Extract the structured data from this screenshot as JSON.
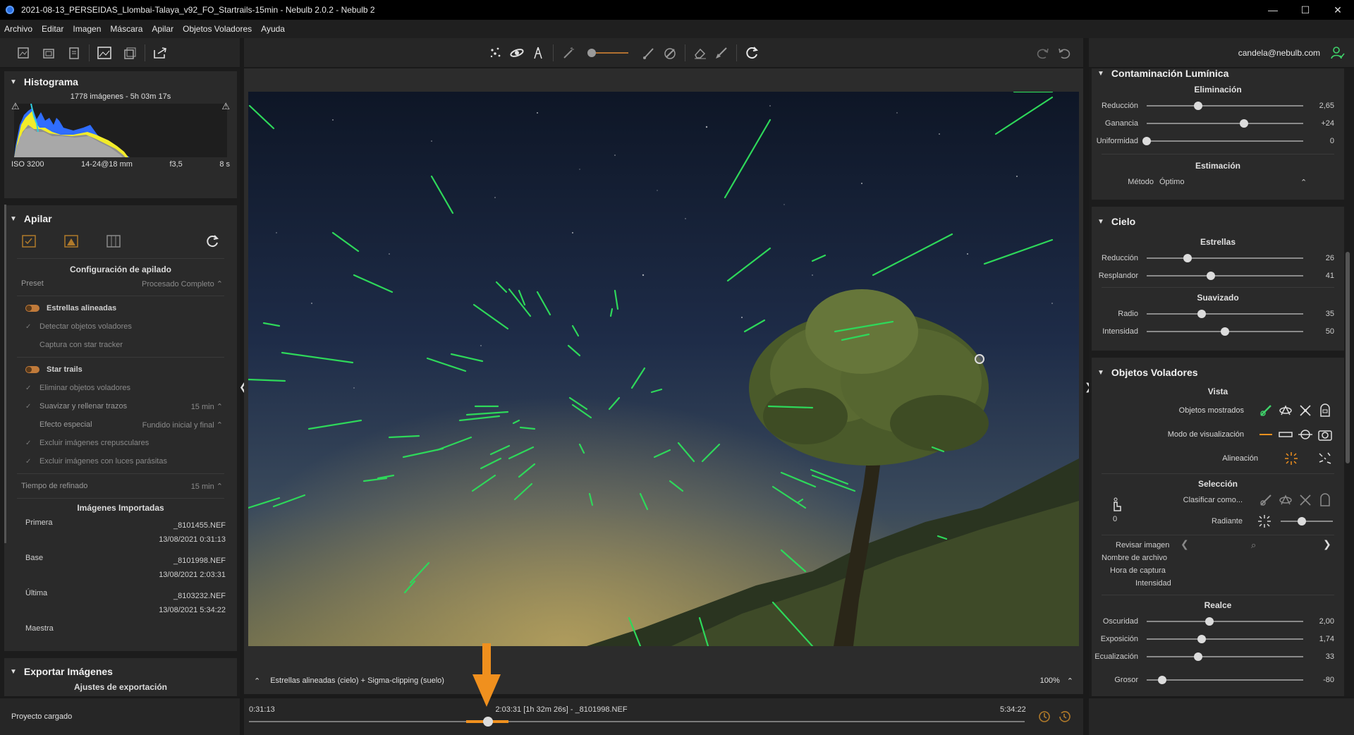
{
  "window": {
    "title": "2021-08-13_PERSEIDAS_Llombai-Talaya_v92_FO_Startrails-15min - Nebulb 2.0.2 - Nebulb 2",
    "minimize": "—",
    "maximize": "☐",
    "close": "✕"
  },
  "menu": [
    "Archivo",
    "Editar",
    "Imagen",
    "Máscara",
    "Apilar",
    "Objetos Voladores",
    "Ayuda"
  ],
  "user": {
    "email": "candela@nebulb.com"
  },
  "histogram": {
    "title": "Histograma",
    "summary": "1778 imágenes - 5h 03m 17s",
    "iso": "ISO 3200",
    "lens": "14-24@18 mm",
    "aperture": "f3,5",
    "exposure": "8 s"
  },
  "stack": {
    "title": "Apilar",
    "config_title": "Configuración de apilado",
    "preset_label": "Preset",
    "preset_value": "Procesado Completo",
    "aligned_stars": "Estrellas alineadas",
    "detect_flying": "Detectar objetos voladores",
    "star_tracker": "Captura con star tracker",
    "star_trails": "Star trails",
    "remove_flying": "Eliminar objetos voladores",
    "smooth_label": "Suavizar y rellenar trazos",
    "smooth_value": "15 min",
    "effect_label": "Efecto especial",
    "effect_value": "Fundido inicial y final",
    "exclude_twilight": "Excluir imágenes crepusculares",
    "exclude_parasite": "Excluir imágenes con luces parásitas",
    "refine_label": "Tiempo de refinado",
    "refine_value": "15 min",
    "imported_title": "Imágenes Importadas",
    "first_label": "Primera",
    "first_file": "_8101455.NEF",
    "first_date": "13/08/2021 0:31:13",
    "base_label": "Base",
    "base_file": "_8101998.NEF",
    "base_date": "13/08/2021 2:03:31",
    "last_label": "Última",
    "last_file": "_8103232.NEF",
    "last_date": "13/08/2021 5:34:22",
    "master_label": "Maestra"
  },
  "export": {
    "title": "Exportar Imágenes",
    "subtitle": "Ajustes de exportación"
  },
  "image_footer": {
    "mode": "Estrellas alineadas (cielo) + Sigma-clipping (suelo)",
    "zoom": "100%"
  },
  "timeline": {
    "start": "0:31:13",
    "current": "2:03:31 [1h 32m 26s] - _8101998.NEF",
    "end": "5:34:22",
    "position": 0.31
  },
  "status": {
    "text": "Proyecto cargado"
  },
  "light_pollution": {
    "title": "Contaminación Lumínica",
    "elim_title": "Eliminación",
    "reduction_label": "Reducción",
    "reduction_value": "2,65",
    "reduction_pos": 0.33,
    "gain_label": "Ganancia",
    "gain_value": "+24",
    "gain_pos": 0.62,
    "uniform_label": "Uniformidad",
    "uniform_value": "0",
    "uniform_pos": 0.0,
    "est_title": "Estimación",
    "method_label": "Método",
    "method_value": "Óptimo"
  },
  "sky": {
    "title": "Cielo",
    "stars_title": "Estrellas",
    "reduction_label": "Reducción",
    "reduction_value": "26",
    "reduction_pos": 0.26,
    "glow_label": "Resplandor",
    "glow_value": "41",
    "glow_pos": 0.41,
    "smooth_title": "Suavizado",
    "radius_label": "Radio",
    "radius_value": "35",
    "radius_pos": 0.35,
    "intensity_label": "Intensidad",
    "intensity_value": "50",
    "intensity_pos": 0.5
  },
  "flying": {
    "title": "Objetos Voladores",
    "view_title": "Vista",
    "shown_label": "Objetos mostrados",
    "mode_label": "Modo de visualización",
    "align_label": "Alineación",
    "selection_title": "Selección",
    "classify_label": "Clasificar como...",
    "count": "0",
    "radiant_label": "Radiante",
    "review_label": "Revisar imagen",
    "filename_label": "Nombre de archivo",
    "capture_label": "Hora de captura",
    "intensity_label": "Intensidad",
    "enhance_title": "Realce",
    "dark_label": "Oscuridad",
    "dark_value": "2,00",
    "dark_pos": 0.4,
    "exposure_label": "Exposición",
    "exposure_value": "1,74",
    "exposure_pos": 0.35,
    "eq_label": "Ecualización",
    "eq_value": "33",
    "eq_pos": 0.33,
    "thick_label": "Grosor",
    "thick_value": "-80",
    "thick_pos": 0.1
  },
  "colors": {
    "accent": "#f0901e",
    "meteor": "#2ed85a",
    "panel": "#2a2a2a"
  }
}
